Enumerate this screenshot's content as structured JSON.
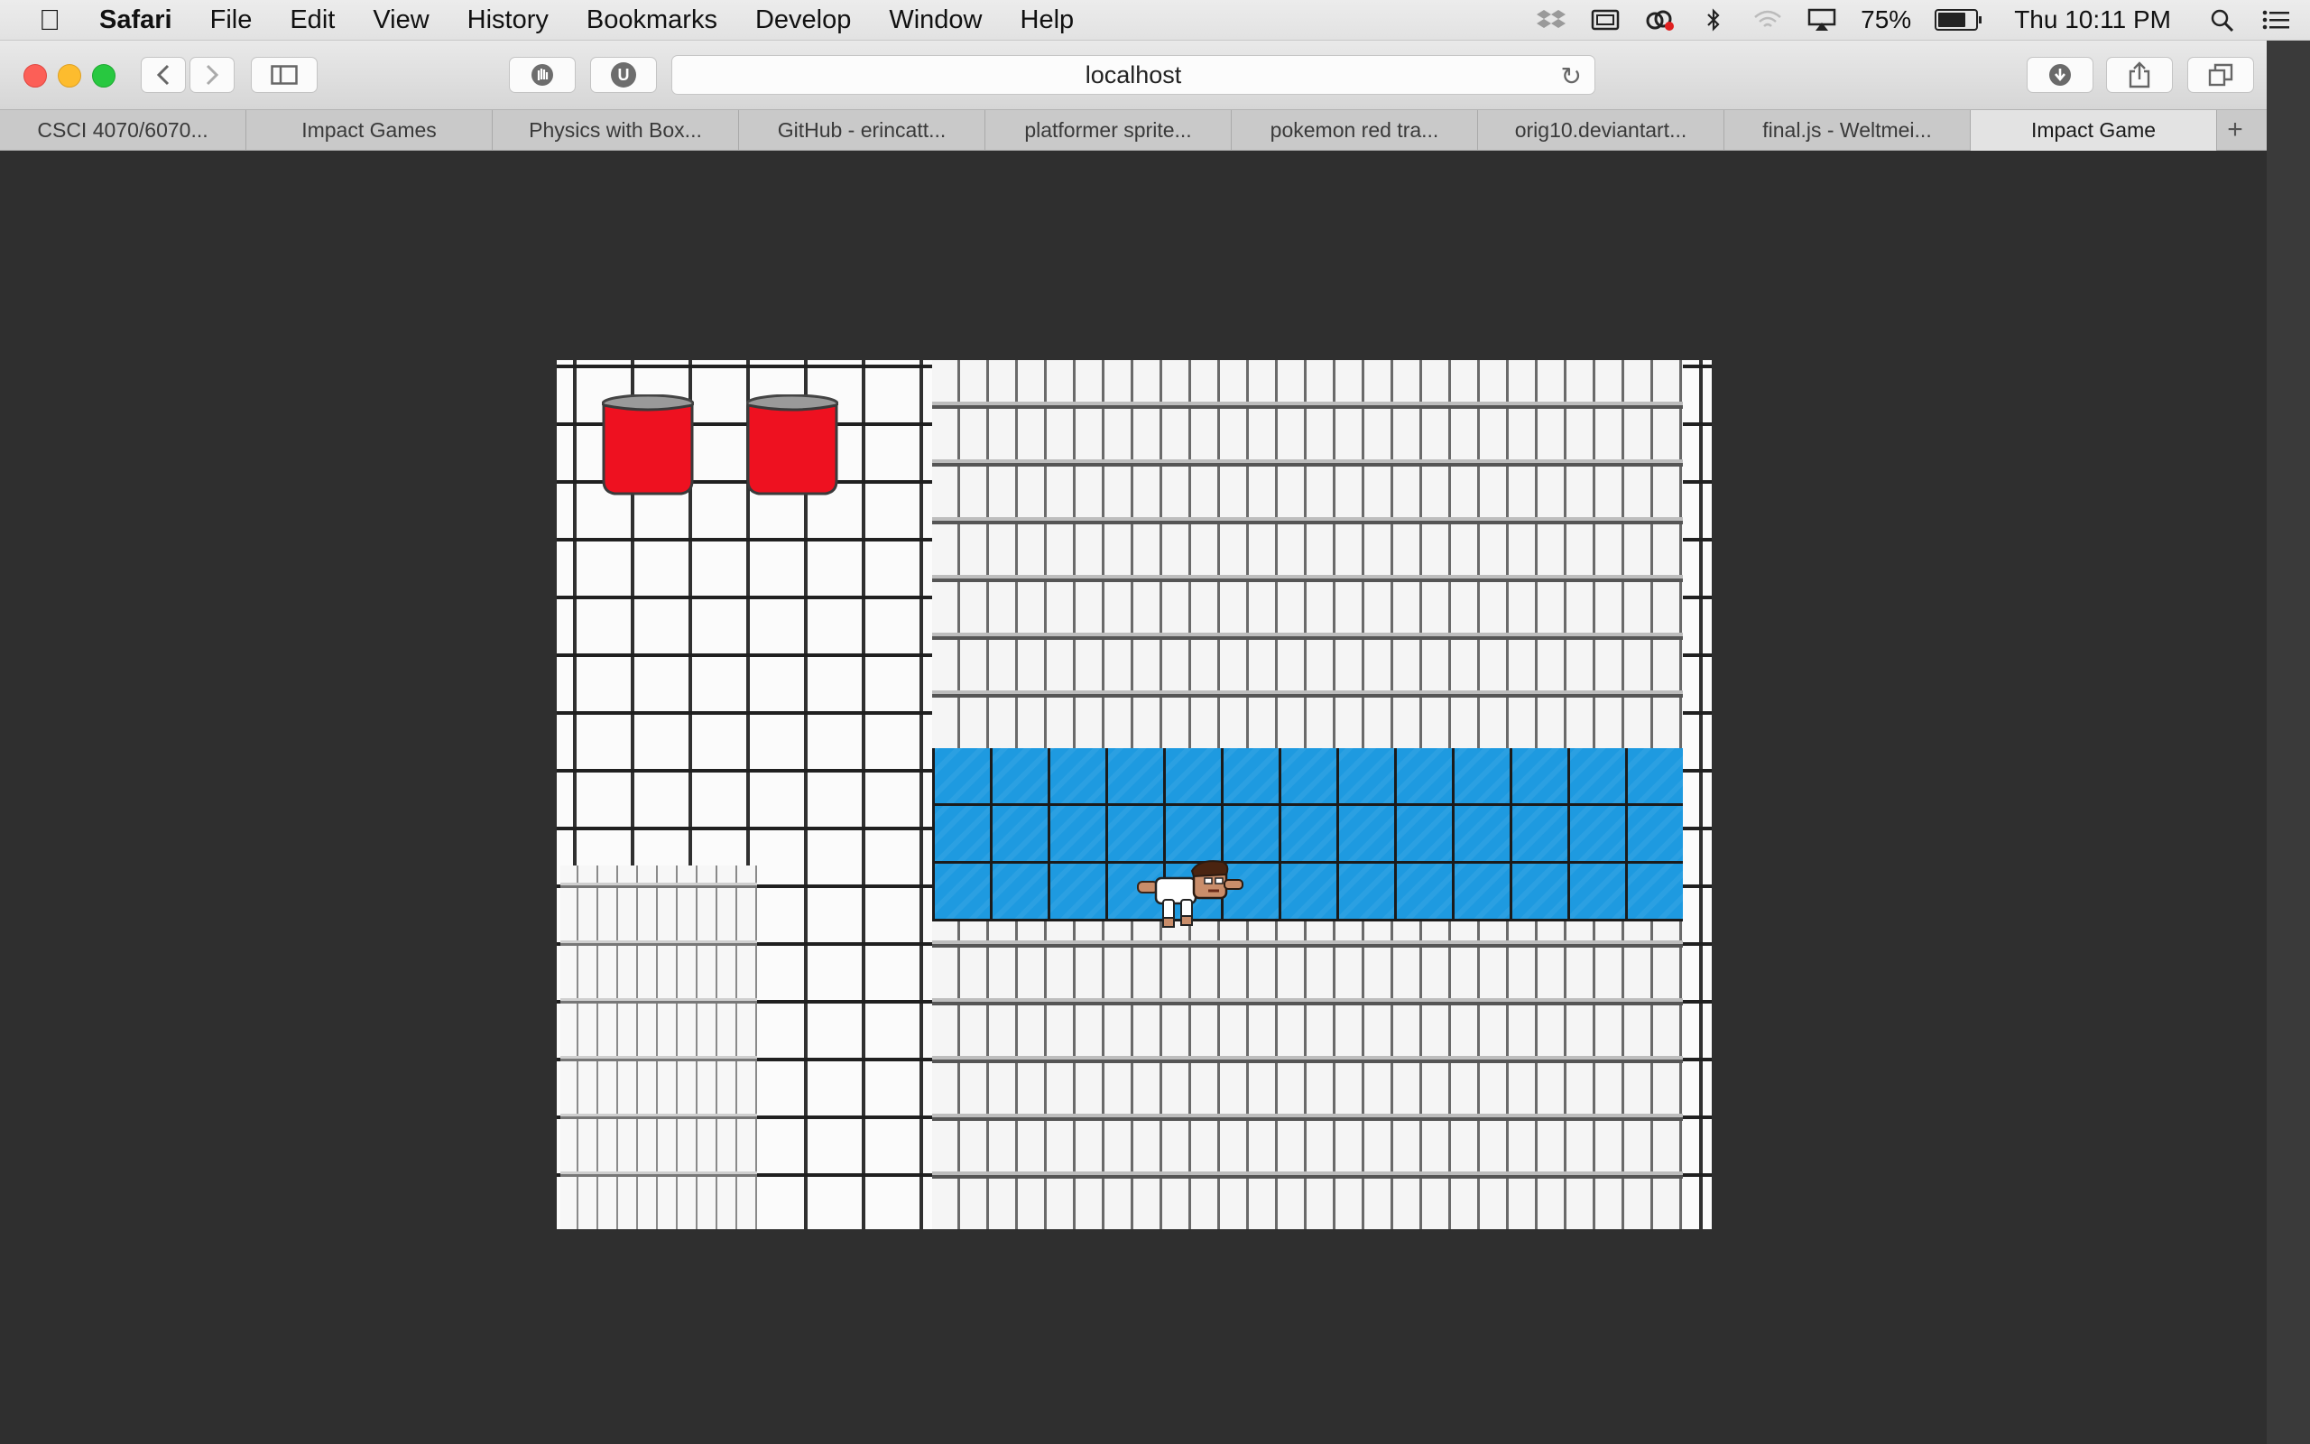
{
  "menubar": {
    "app_name": "Safari",
    "items": [
      "File",
      "Edit",
      "View",
      "History",
      "Bookmarks",
      "Develop",
      "Window",
      "Help"
    ],
    "battery_percent": "75%",
    "clock": "Thu 10:11 PM"
  },
  "toolbar": {
    "url": "localhost",
    "privacy_icon": "hand-icon",
    "extension_label": "U"
  },
  "tabs": [
    {
      "label": "CSCI 4070/6070..."
    },
    {
      "label": "Impact Games"
    },
    {
      "label": "Physics with Box..."
    },
    {
      "label": "GitHub - erincatt..."
    },
    {
      "label": "platformer sprite..."
    },
    {
      "label": "pokemon red tra..."
    },
    {
      "label": "orig10.deviantart..."
    },
    {
      "label": "final.js - Weltmei..."
    },
    {
      "label": "Impact Game",
      "active": true
    }
  ],
  "colors": {
    "water": "#1e9ae0",
    "bucket": "#ee1120",
    "window_bg": "#2f2f2f"
  },
  "game": {
    "objects": [
      "red-bucket",
      "red-bucket",
      "swimming-player"
    ]
  }
}
